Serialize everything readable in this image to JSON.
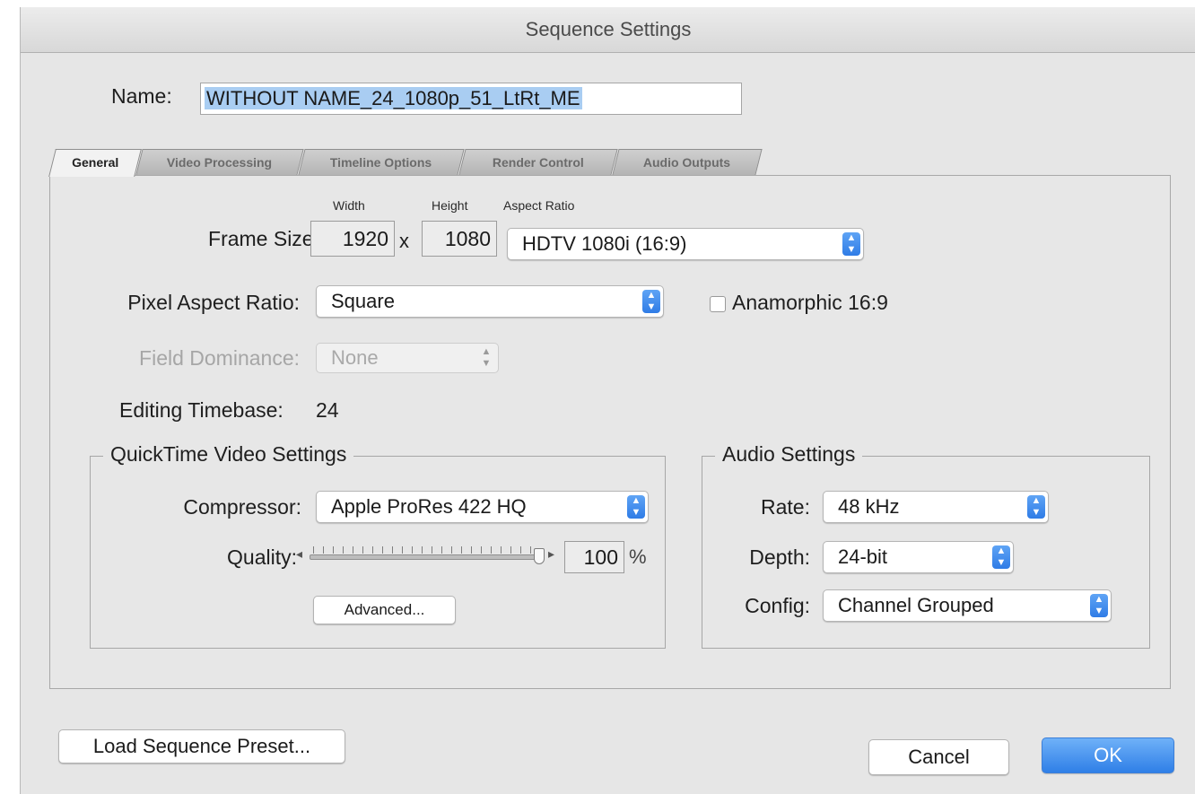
{
  "window": {
    "title": "Sequence Settings"
  },
  "name": {
    "label": "Name:",
    "value": "WITHOUT NAME_24_1080p_51_LtRt_ME"
  },
  "tabs": [
    {
      "label": "General",
      "active": true
    },
    {
      "label": "Video Processing",
      "active": false
    },
    {
      "label": "Timeline Options",
      "active": false
    },
    {
      "label": "Render Control",
      "active": false
    },
    {
      "label": "Audio Outputs",
      "active": false
    }
  ],
  "general": {
    "frame_size": {
      "label": "Frame Size:",
      "width_header": "Width",
      "height_header": "Height",
      "aspect_header": "Aspect Ratio",
      "width": "1920",
      "times": "x",
      "height": "1080",
      "aspect_ratio": "HDTV 1080i (16:9)"
    },
    "pixel_aspect": {
      "label": "Pixel Aspect Ratio:",
      "value": "Square",
      "anamorphic_label": "Anamorphic 16:9",
      "anamorphic_checked": false
    },
    "field_dominance": {
      "label": "Field Dominance:",
      "value": "None",
      "enabled": false
    },
    "editing_timebase": {
      "label": "Editing Timebase:",
      "value": "24"
    },
    "quicktime": {
      "title": "QuickTime Video Settings",
      "compressor_label": "Compressor:",
      "compressor": "Apple ProRes 422 HQ",
      "quality_label": "Quality:",
      "quality_value": "100",
      "quality_unit": "%",
      "quality_fraction": 1.0,
      "advanced_label": "Advanced..."
    },
    "audio": {
      "title": "Audio Settings",
      "rate_label": "Rate:",
      "rate": "48 kHz",
      "depth_label": "Depth:",
      "depth": "24-bit",
      "config_label": "Config:",
      "config": "Channel Grouped"
    }
  },
  "footer": {
    "load_preset_label": "Load Sequence Preset...",
    "cancel_label": "Cancel",
    "ok_label": "OK"
  },
  "colors": {
    "accent": "#2f7fe7",
    "selection": "#a9cdf2"
  }
}
